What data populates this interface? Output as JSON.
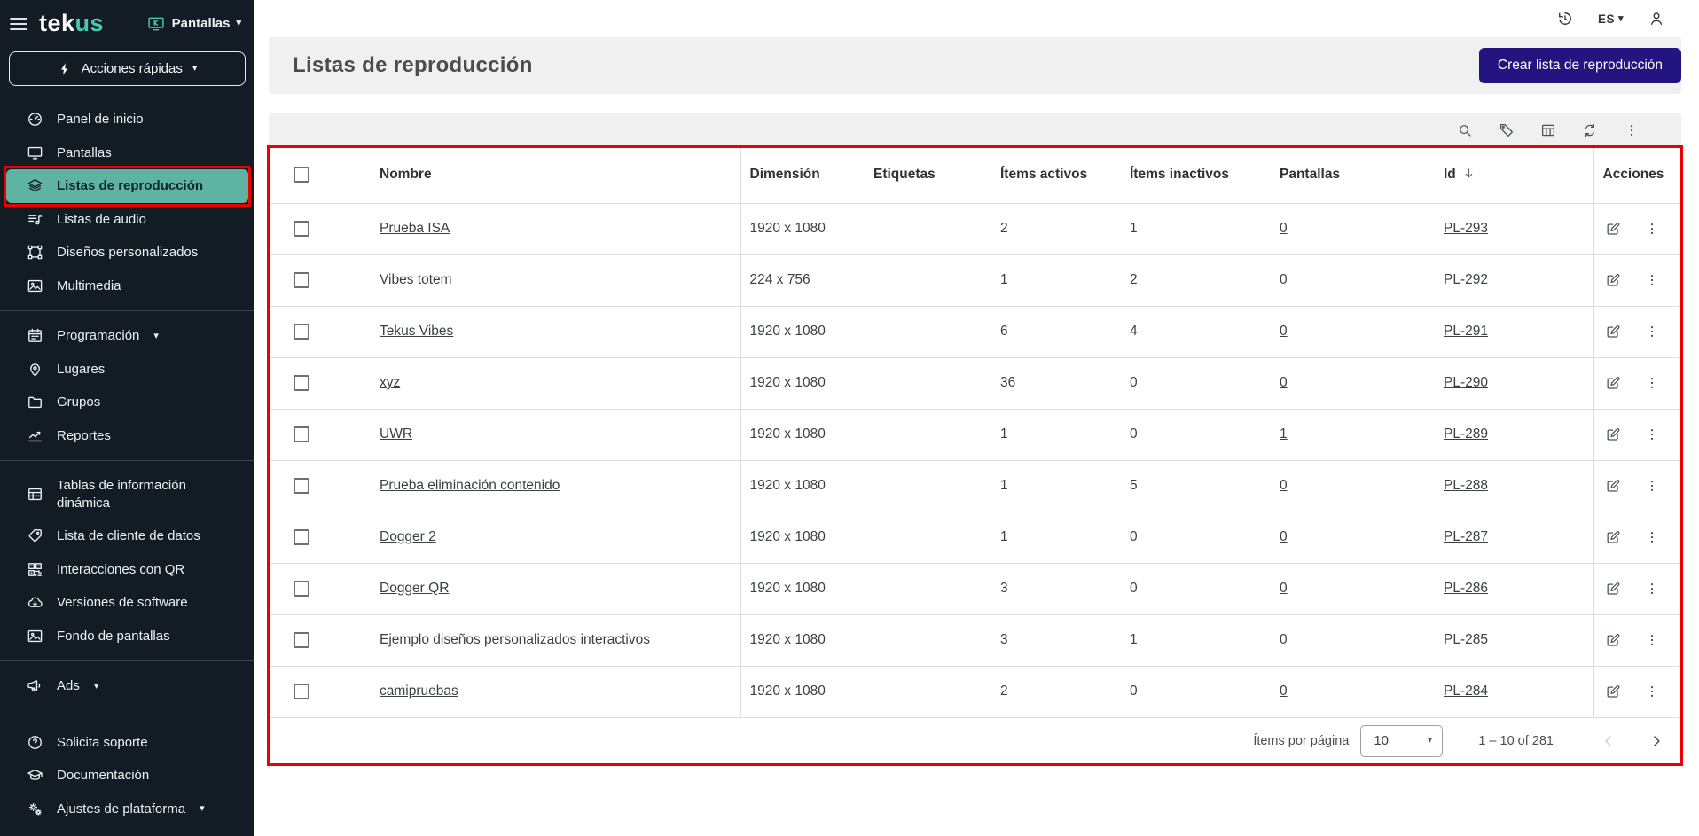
{
  "colors": {
    "sidebar_bg": "#131C25",
    "accent_teal": "#5EB3A2",
    "logo_teal": "#4AC7B2",
    "button_indigo": "#231480",
    "annotation_red": "#EE0000",
    "band_gray": "#F0F0F0"
  },
  "brand": {
    "logo_tek": "tek",
    "logo_us": "us",
    "context_label": "Pantallas",
    "context_icon": "monitor-k-icon"
  },
  "topbar": {
    "language": "ES",
    "icons": [
      "history-icon",
      "user-icon"
    ]
  },
  "sidebar": {
    "quick_actions_label": "Acciones rápidas",
    "sections": [
      {
        "items": [
          {
            "label": "Panel de inicio",
            "icon": "gauge-icon"
          },
          {
            "label": "Pantallas",
            "icon": "monitor-icon"
          },
          {
            "label": "Listas de reproducción",
            "icon": "layers-icon",
            "active": true,
            "annotated": true
          },
          {
            "label": "Listas de audio",
            "icon": "audio-list-icon"
          },
          {
            "label": "Diseños personalizados",
            "icon": "vector-square-icon"
          },
          {
            "label": "Multimedia",
            "icon": "image-icon"
          }
        ]
      },
      {
        "items": [
          {
            "label": "Programación",
            "icon": "calendar-icon",
            "caret": true
          },
          {
            "label": "Lugares",
            "icon": "pin-icon"
          },
          {
            "label": "Grupos",
            "icon": "folder-icon"
          },
          {
            "label": "Reportes",
            "icon": "chart-icon"
          }
        ]
      },
      {
        "items": [
          {
            "label": "Tablas de información dinámica",
            "icon": "table-rows-icon",
            "wrap": true
          },
          {
            "label": "Lista de cliente de datos",
            "icon": "data-client-icon"
          },
          {
            "label": "Interacciones con QR",
            "icon": "qr-icon"
          },
          {
            "label": "Versiones de software",
            "icon": "cloud-download-icon"
          },
          {
            "label": "Fondo de pantallas",
            "icon": "wallpaper-icon"
          }
        ]
      },
      {
        "items": [
          {
            "label": "Ads",
            "icon": "megaphone-icon",
            "caret": true
          }
        ]
      }
    ],
    "footer_items": [
      {
        "label": "Solicita soporte",
        "icon": "help-icon"
      },
      {
        "label": "Documentación",
        "icon": "grad-cap-icon"
      },
      {
        "label": "Ajustes de plataforma",
        "icon": "gears-icon",
        "caret": true
      }
    ]
  },
  "page": {
    "title": "Listas de reproducción",
    "create_button_label": "Crear lista de reproducción"
  },
  "toolbar": {
    "icons": [
      "search-icon",
      "tag-icon",
      "table-icon",
      "sync-icon",
      "kebab-icon"
    ]
  },
  "table": {
    "columns": [
      {
        "key": "select",
        "label": "",
        "type": "checkbox"
      },
      {
        "key": "name",
        "label": "Nombre"
      },
      {
        "key": "dimension",
        "label": "Dimensión",
        "divider_left": true
      },
      {
        "key": "tags",
        "label": "Etiquetas"
      },
      {
        "key": "active_items",
        "label": "Ítems activos"
      },
      {
        "key": "inactive_items",
        "label": "Ítems inactivos"
      },
      {
        "key": "screens",
        "label": "Pantallas"
      },
      {
        "key": "id",
        "label": "Id",
        "sorted": "desc"
      },
      {
        "key": "actions",
        "label": "Acciones",
        "divider_left": true
      }
    ],
    "row_action_icons": [
      "edit-icon",
      "kebab-icon"
    ],
    "rows": [
      {
        "name": "Prueba ISA",
        "dimension": "1920 x 1080",
        "tags": "",
        "active_items": "2",
        "inactive_items": "1",
        "screens": "0",
        "id": "PL-293"
      },
      {
        "name": "Vibes totem",
        "dimension": "224 x 756",
        "tags": "",
        "active_items": "1",
        "inactive_items": "2",
        "screens": "0",
        "id": "PL-292"
      },
      {
        "name": "Tekus Vibes",
        "dimension": "1920 x 1080",
        "tags": "",
        "active_items": "6",
        "inactive_items": "4",
        "screens": "0",
        "id": "PL-291"
      },
      {
        "name": "xyz",
        "dimension": "1920 x 1080",
        "tags": "",
        "active_items": "36",
        "inactive_items": "0",
        "screens": "0",
        "id": "PL-290"
      },
      {
        "name": "UWR",
        "dimension": "1920 x 1080",
        "tags": "",
        "active_items": "1",
        "inactive_items": "0",
        "screens": "1",
        "id": "PL-289"
      },
      {
        "name": "Prueba eliminación contenido",
        "dimension": "1920 x 1080",
        "tags": "",
        "active_items": "1",
        "inactive_items": "5",
        "screens": "0",
        "id": "PL-288"
      },
      {
        "name": "Dogger 2",
        "dimension": "1920 x 1080",
        "tags": "",
        "active_items": "1",
        "inactive_items": "0",
        "screens": "0",
        "id": "PL-287"
      },
      {
        "name": "Dogger QR",
        "dimension": "1920 x 1080",
        "tags": "",
        "active_items": "3",
        "inactive_items": "0",
        "screens": "0",
        "id": "PL-286"
      },
      {
        "name": "Ejemplo diseños personalizados interactivos",
        "dimension": "1920 x 1080",
        "tags": "",
        "active_items": "3",
        "inactive_items": "1",
        "screens": "0",
        "id": "PL-285"
      },
      {
        "name": "camipruebas",
        "dimension": "1920 x 1080",
        "tags": "",
        "active_items": "2",
        "inactive_items": "0",
        "screens": "0",
        "id": "PL-284"
      }
    ]
  },
  "pagination": {
    "items_per_page_label": "Ítems por página",
    "page_size": "10",
    "range": "1 – 10 of 281"
  }
}
